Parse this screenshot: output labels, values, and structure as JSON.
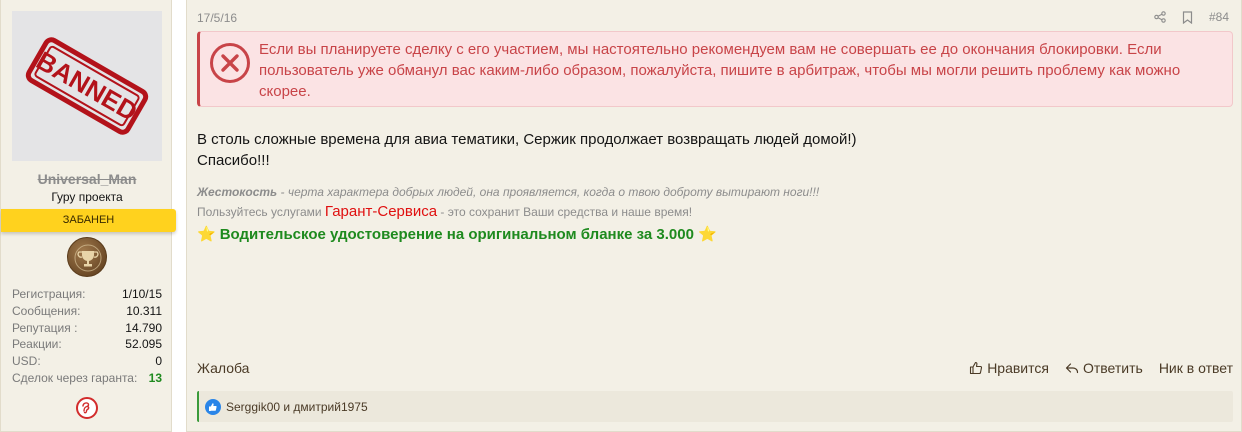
{
  "user": {
    "avatar_stamp": "BANNED",
    "username": "Universal_Man",
    "title": "Гуру проекта",
    "banner": "ЗАБАНЕН",
    "award_icon": "trophy-icon",
    "stats": [
      {
        "label": "Регистрация:",
        "value": "1/10/15"
      },
      {
        "label": "Сообщения:",
        "value": "10.311"
      },
      {
        "label": "Репутация :",
        "value": "14.790"
      },
      {
        "label": "Реакции:",
        "value": "52.095"
      },
      {
        "label": "USD:",
        "value": "0"
      },
      {
        "label": "Сделок через гаранта:",
        "value": "13"
      }
    ],
    "badge_icon": "ear-icon"
  },
  "post": {
    "date": "17/5/16",
    "number": "#84",
    "share_icon": "share-icon",
    "bookmark_icon": "bookmark-icon",
    "warning": "Если вы планируете сделку с его участием, мы настоятельно рекомендуем вам не совершать ее до окончания блокировки. Если пользователь уже обманул вас каким-либо образом, пожалуйста, пишите в арбитраж, чтобы мы могли решить проблему как можно скорее.",
    "body_line1": "В столь сложные времена для авиа тематики, Сержик продолжает возвращать людей домой!)",
    "body_line2": "Спасибо!!!"
  },
  "signature": {
    "quote_bold": "Жестокость",
    "quote_rest": " - черта характера добрых людей, она проявляется, когда о твою доброту вытирают ноги!!!",
    "promo_prefix": "Пользуйтесь услугами ",
    "promo_link": "Гарант-Сервиса",
    "promo_suffix": " - это сохранит Ваши средства и наше время!",
    "ad_text": "Водительское удостоверение на оригинальном бланке за 3.000",
    "star": "⭐"
  },
  "footer": {
    "report": "Жалоба",
    "like": "Нравится",
    "reply": "Ответить",
    "mention": "Ник в ответ"
  },
  "reactions": {
    "text": "Serggik00 и дмитрий1975"
  },
  "colors": {
    "warning_text": "#c84448",
    "warning_bg": "#fbe3e4",
    "banned_banner": "#ffd21e",
    "ad_green": "#1e8a1e",
    "promo_red": "#e01010"
  }
}
